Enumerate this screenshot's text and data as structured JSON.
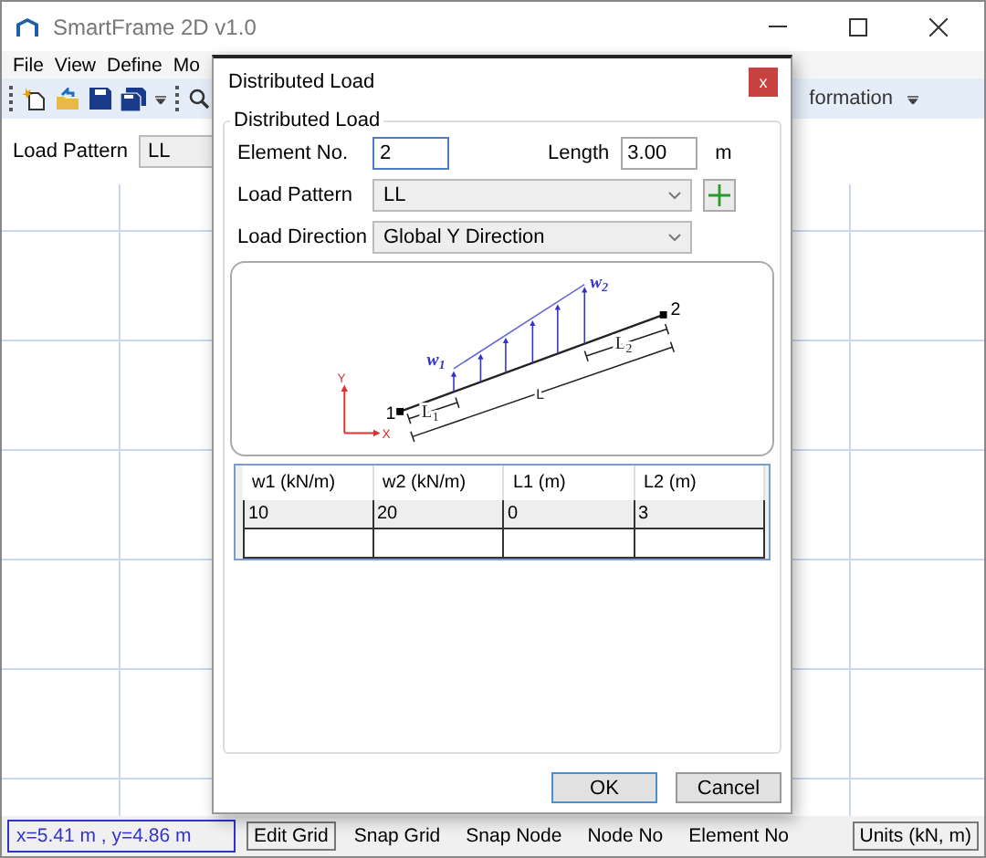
{
  "window": {
    "title": "SmartFrame 2D v1.0"
  },
  "menu": [
    "File",
    "View",
    "Define",
    "Mo"
  ],
  "toolbar": {
    "overflow_text": "formation"
  },
  "load_pattern_bar": {
    "label": "Load Pattern",
    "value": "LL"
  },
  "dialog": {
    "title": "Distributed Load",
    "close": "x",
    "group_title": "Distributed Load",
    "element_label": "Element No.",
    "element_value": "2",
    "length_label": "Length",
    "length_value": "3.00",
    "length_unit": "m",
    "pattern_label": "Load Pattern",
    "pattern_value": "LL",
    "direction_label": "Load Direction",
    "direction_value": "Global Y Direction",
    "diagram": {
      "w1": {
        "text": "w",
        "sub": "1"
      },
      "w2": {
        "text": "w",
        "sub": "2"
      },
      "node1": "1",
      "node2": "2",
      "length": "L",
      "l1": {
        "text": "L",
        "sub": "1"
      },
      "l2": {
        "text": "L",
        "sub": "2"
      },
      "axis_y": "Y",
      "axis_x": "X"
    },
    "table": {
      "columns": [
        "w1 (kN/m)",
        "w2 (kN/m)",
        "L1 (m)",
        "L2 (m)"
      ],
      "rows": [
        [
          "10",
          "20",
          "0",
          "3"
        ]
      ]
    },
    "buttons": [
      "OK",
      "Cancel"
    ]
  },
  "status_bar": {
    "coordinates": "x=5.41 m , y=4.86 m",
    "items": [
      {
        "label": "Edit Grid",
        "on": true
      },
      {
        "label": "Snap Grid",
        "on": false
      },
      {
        "label": "Snap Node",
        "on": false
      },
      {
        "label": "Node No",
        "on": false
      },
      {
        "label": "Element No",
        "on": false
      }
    ],
    "units": "Units (kN, m)"
  }
}
